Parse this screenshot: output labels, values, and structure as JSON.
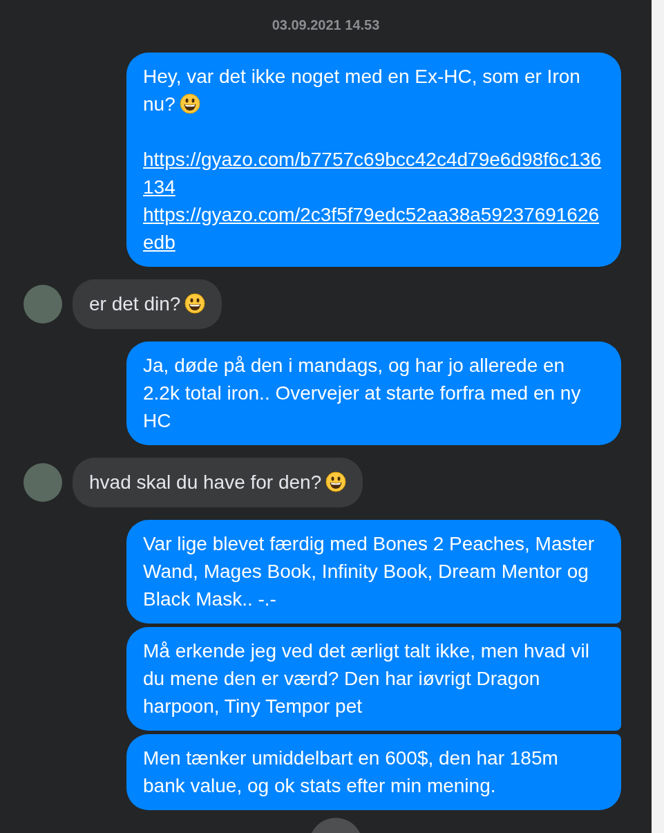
{
  "timestamp": "03.09.2021 14.53",
  "groups": [
    {
      "kind": "outgoing",
      "messages": [
        {
          "parts": [
            {
              "kind": "text",
              "text": "Hey, var det ikke noget med en Ex-HC, som er Iron nu?",
              "emoji": true
            },
            {
              "kind": "link",
              "text": "https://gyazo.com/b7757c69bcc42c4d79e6d98f6c136134"
            },
            {
              "kind": "link",
              "text": "https://gyazo.com/2c3f5f79edc52aa38a59237691626edb"
            }
          ]
        }
      ]
    },
    {
      "kind": "incoming",
      "messages": [
        {
          "parts": [
            {
              "kind": "text",
              "text": "er det din?",
              "emoji": true
            }
          ]
        }
      ]
    },
    {
      "kind": "outgoing",
      "messages": [
        {
          "parts": [
            {
              "kind": "text",
              "text": "Ja, døde på den i mandags, og har jo allerede en 2.2k total iron.. Overvejer at starte forfra med en ny HC",
              "emoji": false
            }
          ]
        }
      ]
    },
    {
      "kind": "incoming",
      "messages": [
        {
          "parts": [
            {
              "kind": "text",
              "text": "hvad skal du have for den?",
              "emoji": true
            }
          ]
        }
      ]
    },
    {
      "kind": "outgoing",
      "messages": [
        {
          "parts": [
            {
              "kind": "text",
              "text": "Var lige blevet færdig med Bones 2 Peaches, Master Wand, Mages Book, Infinity Book, Dream Mentor og Black Mask.. -.-",
              "emoji": false
            }
          ]
        },
        {
          "parts": [
            {
              "kind": "text",
              "text": "Må erkende jeg ved det ærligt talt ikke, men hvad vil du mene den er værd? Den har iøvrigt Dragon harpoon, Tiny Tempor pet",
              "emoji": false
            }
          ]
        },
        {
          "parts": [
            {
              "kind": "text",
              "text": "Men tænker umiddelbart en 600$, den har 185m bank value, og ok stats efter min mening.",
              "emoji": false
            }
          ]
        }
      ]
    }
  ]
}
